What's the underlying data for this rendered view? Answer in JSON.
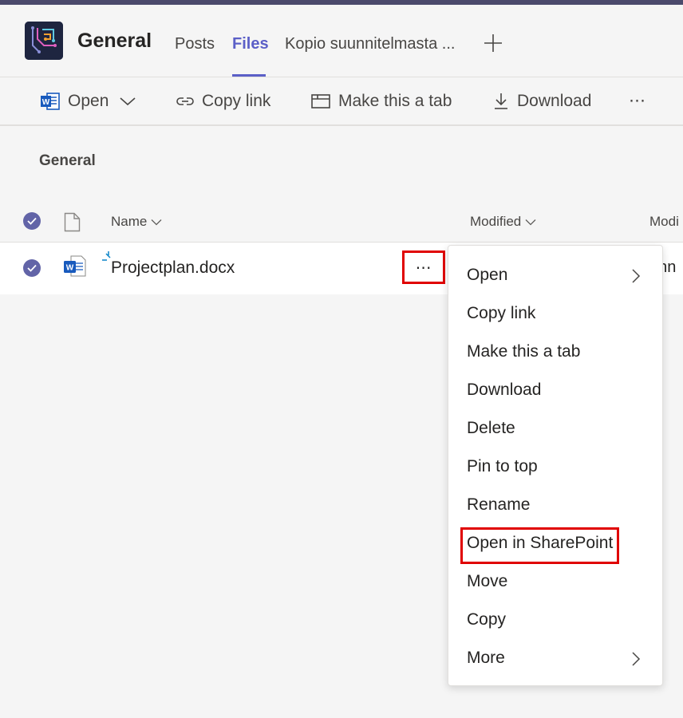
{
  "header": {
    "channel_title": "General",
    "tabs": [
      {
        "label": "Posts",
        "active": false
      },
      {
        "label": "Files",
        "active": true
      },
      {
        "label": "Kopio suunnitelmasta ...",
        "active": false
      }
    ],
    "add_tab_icon": "plus-icon"
  },
  "toolbar": {
    "open_label": "Open",
    "copy_link_label": "Copy link",
    "make_tab_label": "Make this a tab",
    "download_label": "Download",
    "more_label": "⋯"
  },
  "folder": {
    "title": "General"
  },
  "list": {
    "columns": {
      "name": "Name",
      "modified": "Modified",
      "modified_by": "Modi"
    },
    "rows": [
      {
        "name": "Projectplan.docx",
        "more_label": "⋯",
        "modified_by": "ann"
      }
    ]
  },
  "context_menu": {
    "items": [
      {
        "label": "Open",
        "has_submenu": true
      },
      {
        "label": "Copy link",
        "has_submenu": false
      },
      {
        "label": "Make this a tab",
        "has_submenu": false
      },
      {
        "label": "Download",
        "has_submenu": false
      },
      {
        "label": "Delete",
        "has_submenu": false
      },
      {
        "label": "Pin to top",
        "has_submenu": false
      },
      {
        "label": "Rename",
        "has_submenu": false
      },
      {
        "label": "Open in SharePoint",
        "has_submenu": false,
        "highlighted": true
      },
      {
        "label": "Move",
        "has_submenu": false
      },
      {
        "label": "Copy",
        "has_submenu": false
      },
      {
        "label": "More",
        "has_submenu": true
      }
    ]
  },
  "colors": {
    "accent": "#5b5fc7",
    "check": "#6264a7",
    "highlight": "#e00000",
    "word_blue": "#185abd"
  }
}
